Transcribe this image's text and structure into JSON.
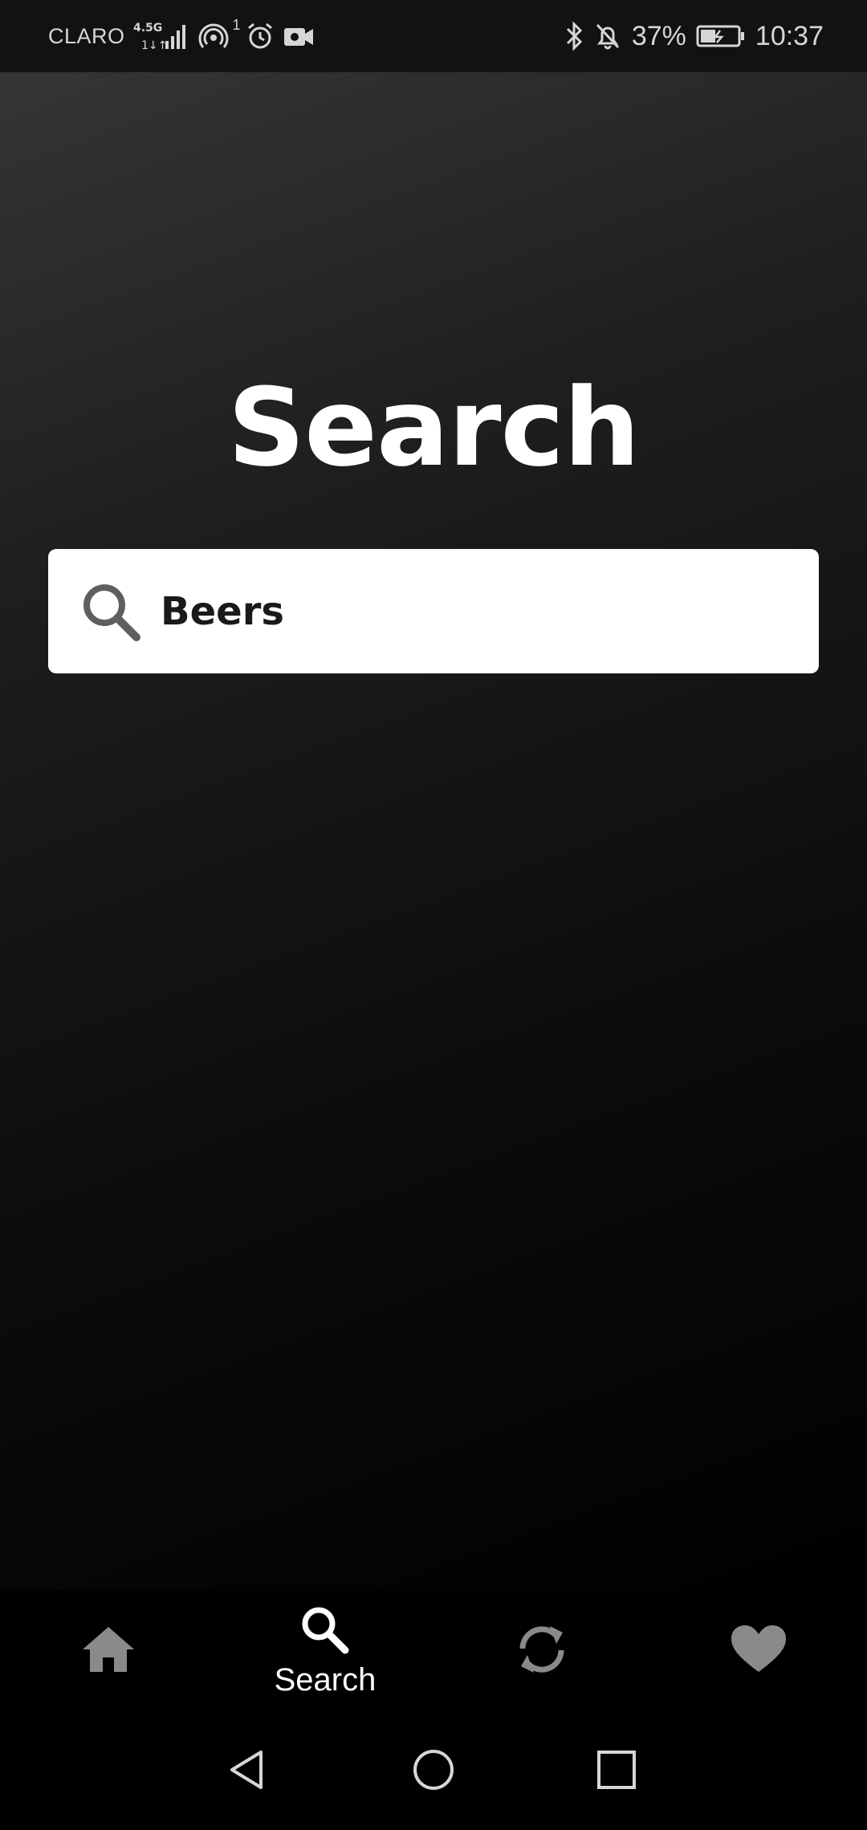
{
  "status_bar": {
    "carrier": "CLARO",
    "network": "4.5G",
    "sim_badge": "1",
    "battery_percent": "37%",
    "time": "10:37",
    "icons": [
      "signal-icon",
      "hotspot-icon",
      "alarm-icon",
      "video-icon",
      "bluetooth-icon",
      "notifications-off-icon",
      "battery-charging-icon"
    ]
  },
  "main": {
    "title": "Search",
    "search": {
      "value": "Beers",
      "placeholder": ""
    }
  },
  "bottom_nav": {
    "items": [
      {
        "id": "home",
        "icon": "home-icon",
        "label": "",
        "active": false
      },
      {
        "id": "search",
        "icon": "search-icon",
        "label": "Search",
        "active": true
      },
      {
        "id": "refresh",
        "icon": "refresh-icon",
        "label": "",
        "active": false
      },
      {
        "id": "favorites",
        "icon": "heart-icon",
        "label": "",
        "active": false
      }
    ]
  },
  "system_nav": {
    "buttons": [
      "back-icon",
      "home-circle-icon",
      "recents-icon"
    ]
  },
  "colors": {
    "background_top": "#353535",
    "background_bottom": "#000000",
    "text_primary": "#ffffff",
    "nav_inactive": "#8a8a8a",
    "search_bg": "#ffffff",
    "search_text": "#1a1a1a",
    "search_icon": "#5f5f5f"
  }
}
